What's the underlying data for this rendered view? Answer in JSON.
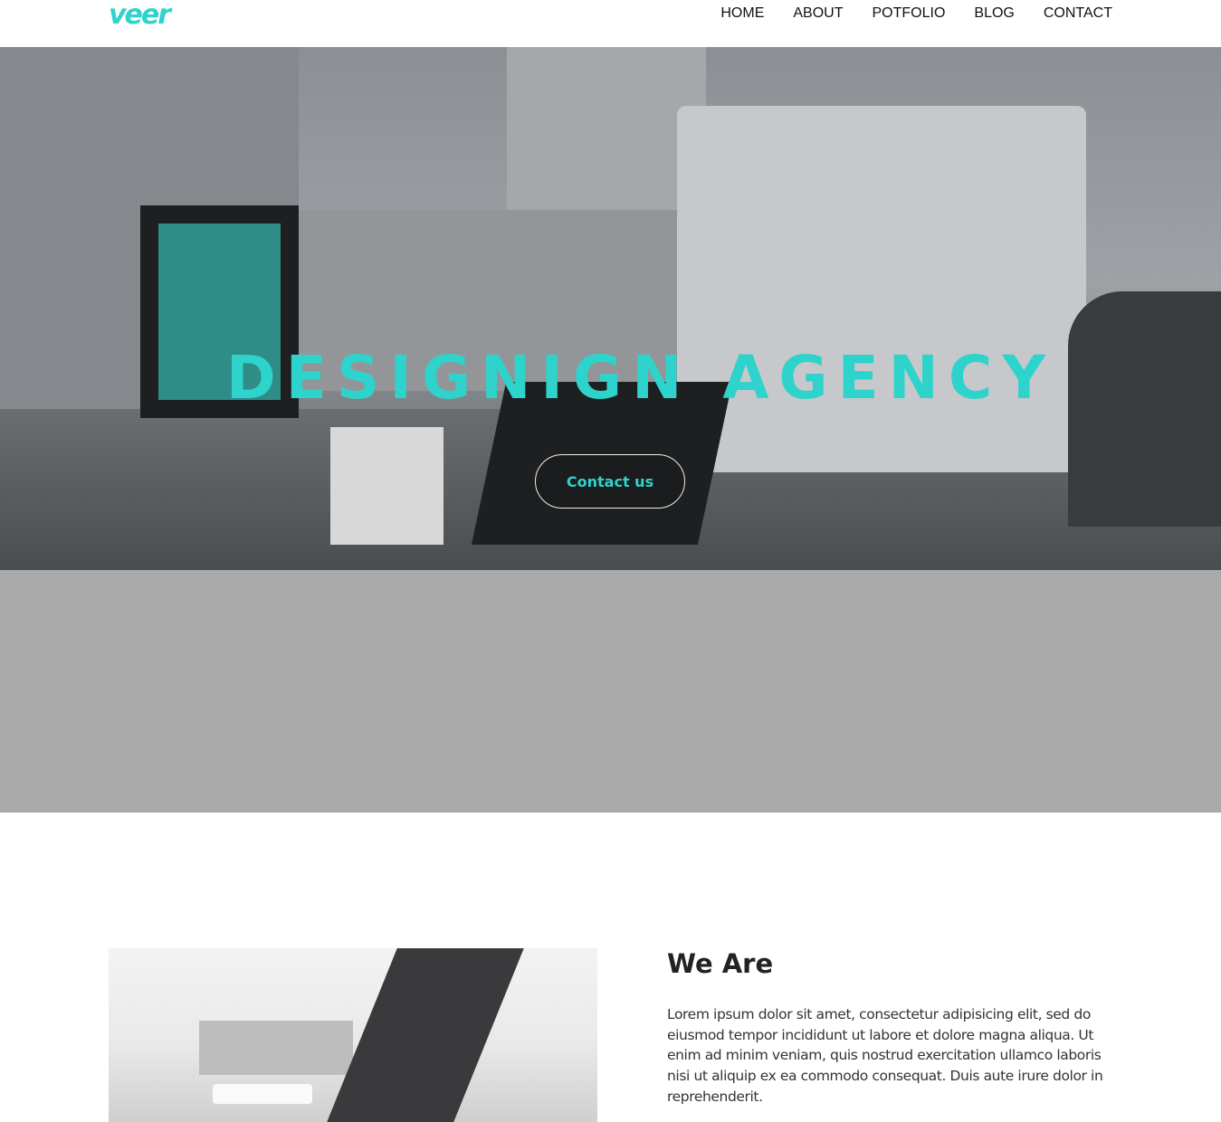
{
  "header": {
    "logo": "veer",
    "nav": [
      "HOME",
      "ABOUT",
      "POTFOLIO",
      "BLOG",
      "CONTACT"
    ]
  },
  "hero": {
    "title": "DESIGNIGN AGENCY",
    "cta_label": "Contact us"
  },
  "about": {
    "title": "We Are",
    "text": "Lorem ipsum dolor sit amet, consectetur adipisicing elit, sed do eiusmod tempor incididunt ut labore et dolore magna aliqua. Ut enim ad minim veniam, quis nostrud exercitation ullamco laboris nisi ut aliquip ex ea commodo consequat. Duis aute irure dolor in reprehenderit."
  },
  "colors": {
    "accent": "#2ed3cc",
    "band": "#aaaaaa"
  }
}
